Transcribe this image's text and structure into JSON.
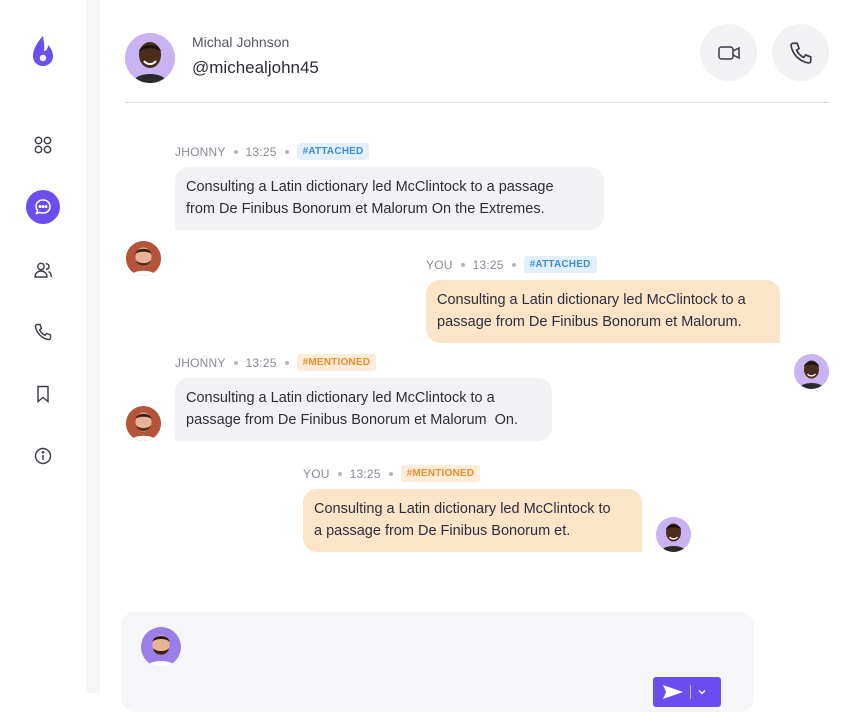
{
  "sidebar": {
    "items": [
      {
        "name": "dashboard-icon"
      },
      {
        "name": "chat-icon",
        "active": true
      },
      {
        "name": "users-icon"
      },
      {
        "name": "phone-icon"
      },
      {
        "name": "bookmark-icon"
      },
      {
        "name": "info-icon"
      }
    ],
    "accent": "#6c4ef0"
  },
  "header": {
    "name": "Michal Johnson",
    "handle": "@michealjohn45",
    "actions": [
      "video-call-icon",
      "phone-call-icon"
    ]
  },
  "messages": [
    {
      "sender": "JHONNY",
      "time": "13:25",
      "tag": "#ATTACHED",
      "tag_type": "attached",
      "direction": "in",
      "text_lines": [
        "Consulting a Latin dictionary led McClintock to a passage",
        "from De Finibus Bonorum et Malorum On the Extremes."
      ]
    },
    {
      "sender": "YOU",
      "time": "13:25",
      "tag": "#ATTACHED",
      "tag_type": "attached",
      "direction": "out",
      "text_lines": [
        "Consulting a Latin dictionary led McClintock to a",
        "passage from De Finibus Bonorum et Malorum."
      ]
    },
    {
      "sender": "JHONNY",
      "time": "13:25",
      "tag": "#MENTIONED",
      "tag_type": "mentioned",
      "direction": "in",
      "text_lines": [
        "Consulting a Latin dictionary led McClintock to a",
        "passage from De Finibus Bonorum et Malorum  On."
      ]
    },
    {
      "sender": "YOU",
      "time": "13:25",
      "tag": "#MENTIONED",
      "tag_type": "mentioned",
      "direction": "out",
      "text_lines": [
        "Consulting a Latin dictionary led McClintock to",
        "a passage from De Finibus Bonorum et."
      ]
    }
  ],
  "colors": {
    "incoming_bubble": "#f2f2f4",
    "outgoing_bubble": "#fbe4c8",
    "attached_tag": "#3a8fd9",
    "mentioned_tag": "#ef8d2a"
  }
}
